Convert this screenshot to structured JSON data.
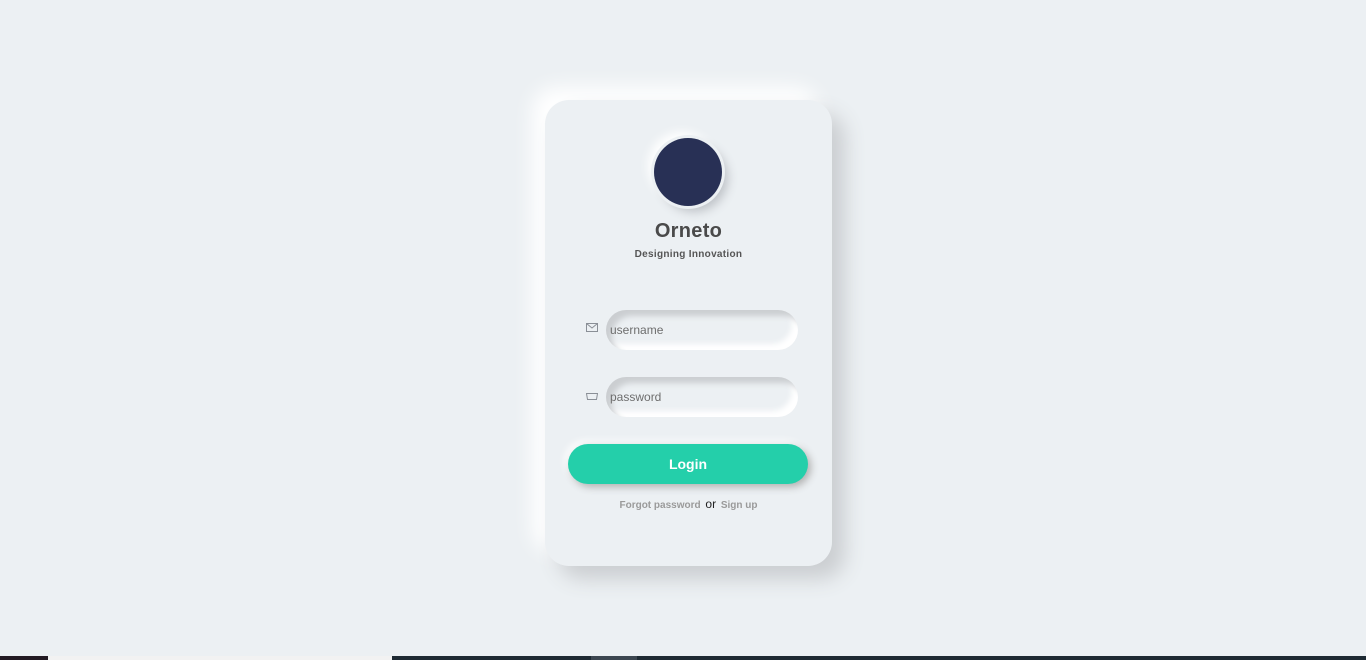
{
  "brand": {
    "name": "Orneto",
    "tagline": "Designing Innovation",
    "logo_color": "#283055"
  },
  "form": {
    "username_placeholder": "username",
    "username_icon": "envelope-icon",
    "password_placeholder": "password",
    "password_icon": "lock-icon",
    "login_label": "Login",
    "accent_color": "#24cfaa"
  },
  "footer_links": {
    "forgot_label": "Forgot password",
    "separator": "or",
    "signup_label": "Sign up"
  },
  "background_color": "#ecf0f3"
}
